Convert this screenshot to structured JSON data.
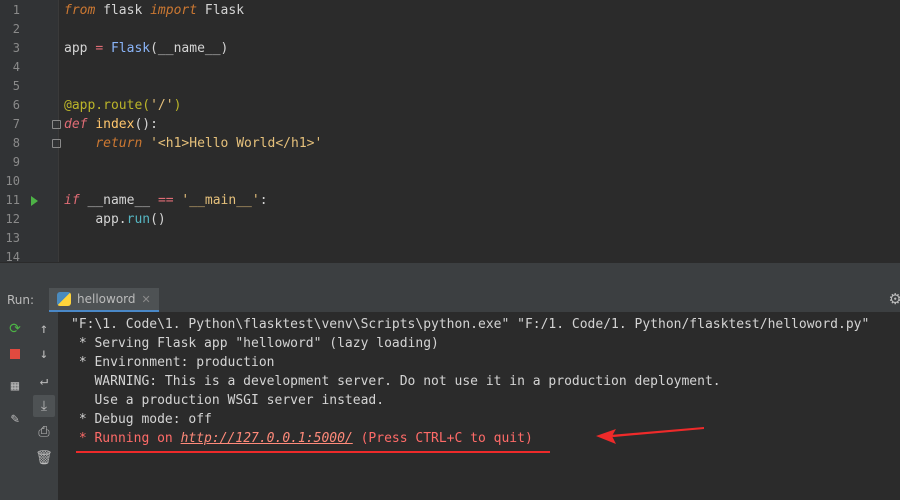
{
  "editor": {
    "lines": [
      {
        "n": "1"
      },
      {
        "n": "2"
      },
      {
        "n": "3"
      },
      {
        "n": "4"
      },
      {
        "n": "5"
      },
      {
        "n": "6"
      },
      {
        "n": "7"
      },
      {
        "n": "8"
      },
      {
        "n": "9"
      },
      {
        "n": "10"
      },
      {
        "n": "11"
      },
      {
        "n": "12"
      },
      {
        "n": "13"
      },
      {
        "n": "14"
      }
    ],
    "code": {
      "l1": {
        "from": "from",
        "mod": " flask ",
        "import": "import",
        "name": " Flask"
      },
      "l3": {
        "a": "app ",
        "eq": "=",
        "b": " ",
        "cls": "Flask",
        "c": "(__name__)"
      },
      "l6": {
        "deco": "@app.route(",
        "str": "'/'",
        "c": ")"
      },
      "l7": {
        "def": "def",
        "sp": " ",
        "fn": "index",
        "c": "():"
      },
      "l8": {
        "ind": "    ",
        "ret": "return",
        "sp": " ",
        "str": "'<h1>Hello World</h1>'"
      },
      "l11": {
        "if": "if",
        "a": " __name__ ",
        "eq": "==",
        "b": " ",
        "str": "'__main__'",
        "c": ":"
      },
      "l12": {
        "ind": "    ",
        "a": "app.",
        "m": "run",
        "c": "()"
      }
    }
  },
  "runbar": {
    "label": "Run:",
    "tab": "helloword",
    "close": "✕",
    "gear_icon": "gear-icon"
  },
  "console": {
    "l1": "\"F:\\1. Code\\1. Python\\flasktest\\venv\\Scripts\\python.exe\" \"F:/1. Code/1. Python/flasktest/helloword.py\"",
    "l2": " * Serving Flask app \"helloword\" (lazy loading)",
    "l3": " * Environment: production",
    "l4": "   WARNING: This is a development server. Do not use it in a production deployment.",
    "l5": "   Use a production WSGI server instead.",
    "l6": " * Debug mode: off",
    "l7a": " * Running on ",
    "l7link": "http://127.0.0.1:5000/",
    "l7b": " (Press CTRL+C to quit)"
  },
  "annotation_color": "#ee2a2a"
}
